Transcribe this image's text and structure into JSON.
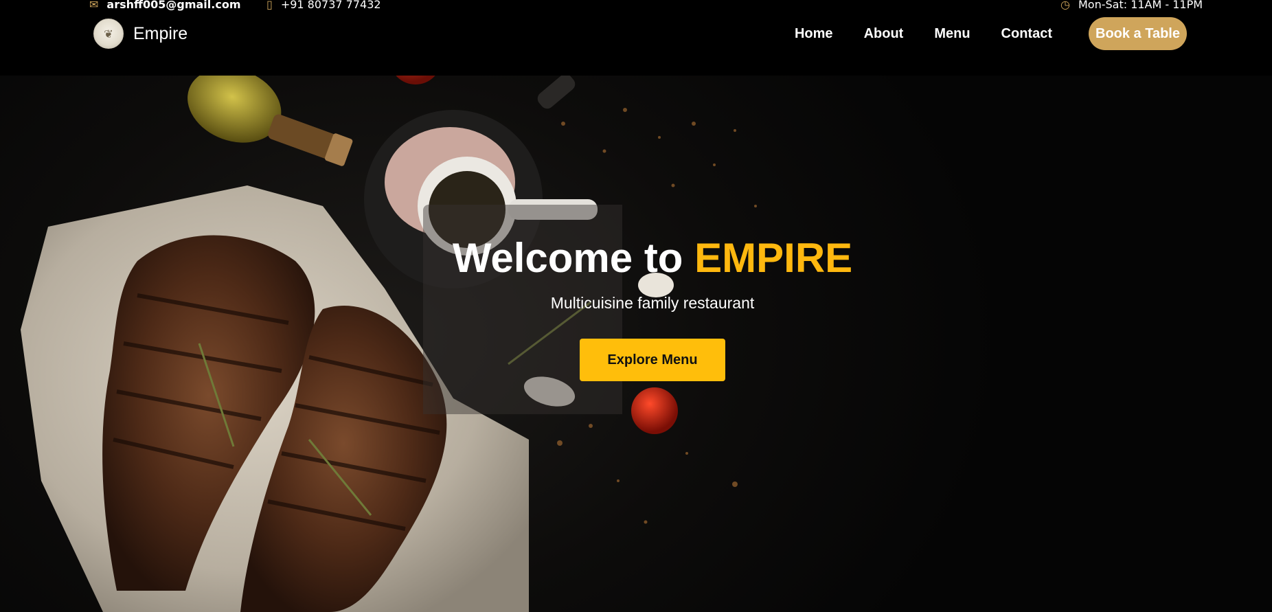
{
  "topbar": {
    "email": "arshff005@gmail.com",
    "phone": "+91 80737 77432",
    "hours": "Mon-Sat: 11AM - 11PM",
    "email_icon": "mail-icon",
    "phone_icon": "phone-icon",
    "clock_icon": "clock-icon"
  },
  "brand": {
    "name": "Empire"
  },
  "nav": {
    "items": [
      {
        "label": "Home"
      },
      {
        "label": "About"
      },
      {
        "label": "Menu"
      },
      {
        "label": "Contact"
      }
    ],
    "cta": "Book a Table"
  },
  "hero": {
    "title_main": "Welcome to ",
    "title_accent": "EMPIRE",
    "subtitle": "Multicuisine family restaurant",
    "button": "Explore Menu"
  },
  "colors": {
    "accent_gold": "#cfa55b",
    "accent_yellow": "#ffb80f",
    "button_yellow": "#ffbe0b",
    "background": "#070707"
  }
}
